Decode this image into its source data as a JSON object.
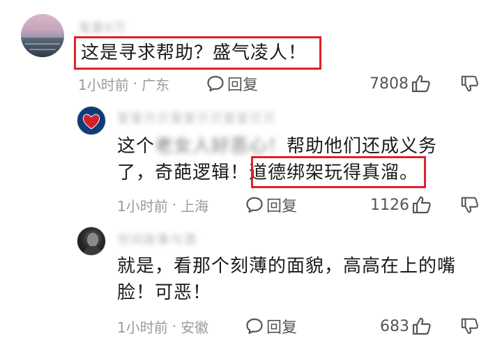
{
  "comments": [
    {
      "username": "鬼雷8万",
      "text": "这是寻求帮助？盛气凌人！",
      "time": "1小时前",
      "location": "广东",
      "reply_label": "回复",
      "likes": "7808"
    },
    {
      "username": "爱爱贝贝爱爱贝贝爱爱贝贝",
      "text_line1_pre": "这个",
      "text_line1_blur": "老女人好恶心！",
      "text_line1_post": "帮助他们还成义务",
      "text_line2_pre": "了，奇葩逻辑！",
      "text_line2_hl": "道德绑架玩得真溜。",
      "time": "1小时前",
      "location": "上海",
      "reply_label": "回复",
      "likes": "1126"
    },
    {
      "username": "世间故事与酒",
      "text_line1": "就是，看那个刻薄的面貌，高高在上的嘴",
      "text_line2": "脸！可恶！",
      "time": "1小时前",
      "location": "安徽",
      "reply_label": "回复",
      "likes": "683"
    }
  ],
  "meta_separator": "·",
  "highlight_color": "#e0212a"
}
